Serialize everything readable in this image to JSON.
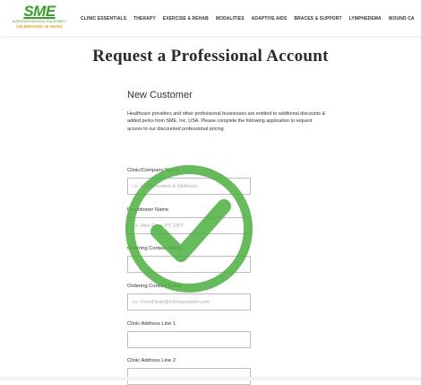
{
  "header": {
    "logo": {
      "mark": "SME",
      "subtitle": "SUPERIOR MEDICAL EQUIPMENT",
      "celebrating": "CELEBRATING 30 YEARS"
    },
    "nav": [
      "CLINIC ESSENTIALS",
      "THERAPY",
      "EXERCISE & REHAB",
      "MODALITIES",
      "ADAPTIVE AIDS",
      "BRACES & SUPPORT",
      "LYMPHEDEMA",
      "WOUND CA"
    ]
  },
  "page": {
    "title": "Request a Professional Account"
  },
  "form": {
    "section_title": "New Customer",
    "intro": "Healthcare providers and other professional businesses are entitled to additional discounts & added perks from SME, Inc. USA. Please complete the following application to request access to our discounted professional pricing.",
    "fields": [
      {
        "label": "Clinic/Company Name",
        "placeholder": "i.e. In2Movement & Wellness",
        "value": ""
      },
      {
        "label": "Practitioner Name",
        "placeholder": "i.e. Alex Grey, PT, DPT",
        "value": ""
      },
      {
        "label": "Ordering Contact Name",
        "placeholder": "",
        "value": ""
      },
      {
        "label": "Ordering Contact Email",
        "placeholder": "i.e. FrontDesk@in2movement.com",
        "value": ""
      },
      {
        "label": "Clinic Address Line 1",
        "placeholder": "",
        "value": ""
      },
      {
        "label": "Clinic Address Line 2",
        "placeholder": "",
        "value": ""
      }
    ]
  },
  "overlay": {
    "icon": "checkmark-circle-icon",
    "color": "#4caf3f"
  },
  "colors": {
    "brand_green": "#3c9a2e",
    "brand_gold": "#e0a21a"
  }
}
